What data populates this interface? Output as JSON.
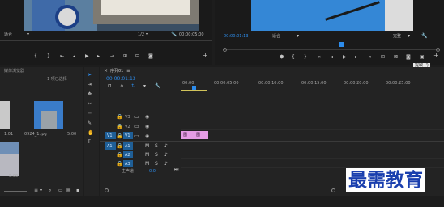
{
  "source_monitor": {
    "fit_value": "适合",
    "page_value": "1/2",
    "timecode": "00:00:05:00"
  },
  "program_monitor": {
    "timecode": "00:00:01:13",
    "fit_value": "适合",
    "quality_value": "完整",
    "tooltip": "提取 (')"
  },
  "project_panel": {
    "title": "媒体浏览器",
    "count": "1 项已选择",
    "clips": [
      {
        "name": "1.01",
        "duration": ""
      },
      {
        "name": "0924_1.jpg",
        "duration": "5:00"
      },
      {
        "name": "",
        "duration": "5:00"
      }
    ]
  },
  "sequence": {
    "tab_label": "序列01",
    "timecode": "00:00:01:13",
    "ruler_labels": [
      "00:00",
      "00:00:05:00",
      "00:00:10:00",
      "00:00:15:00",
      "00:00:20:00",
      "00:00:25:00"
    ],
    "video_tracks": [
      "V3",
      "V2",
      "V1"
    ],
    "audio_tracks": [
      "A1",
      "A2",
      "A3"
    ],
    "source_patch_video": "V1",
    "source_patch_audio": "A1",
    "master_label": "主声道",
    "master_value": "0.0",
    "clip_labels": [
      "图",
      "图"
    ]
  },
  "watermark": "最需教育",
  "colors": {
    "accent": "#2d8ceb",
    "clip": "#e59de5",
    "track_blue": "#1f5f97"
  }
}
